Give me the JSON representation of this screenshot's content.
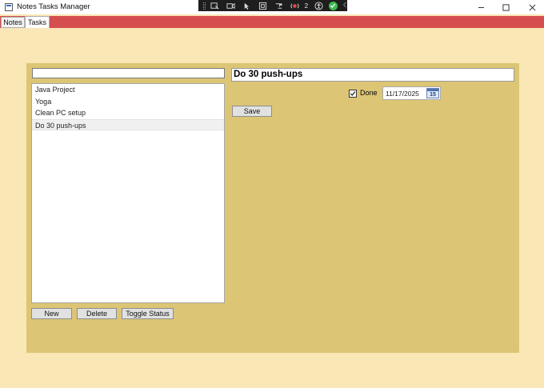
{
  "window": {
    "title": "Notes Tasks Manager",
    "debug_counter": "2"
  },
  "tabs": [
    {
      "label": "Notes"
    },
    {
      "label": "Tasks"
    }
  ],
  "tasks_panel": {
    "filter_value": "",
    "items": [
      {
        "label": "Java Project"
      },
      {
        "label": "Yoga"
      },
      {
        "label": "Clean PC setup"
      },
      {
        "label": "Do 30 push-ups"
      }
    ],
    "selected_index": 3,
    "new_label": "New",
    "delete_label": "Delete",
    "toggle_label": "Toggle Status"
  },
  "detail": {
    "title_value": "Do 30 push-ups",
    "done_checked": true,
    "done_label": "Done",
    "date_value": "11/17/2025",
    "calendar_day": "15",
    "save_label": "Save"
  },
  "colors": {
    "tab_strip": "#d64f4f",
    "background": "#f9e7b5",
    "panel": "#dcc575"
  }
}
